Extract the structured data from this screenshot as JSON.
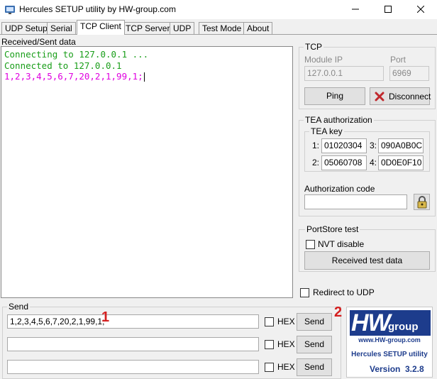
{
  "window": {
    "title": "Hercules SETUP utility by HW-group.com"
  },
  "tabs": [
    {
      "label": "UDP Setup"
    },
    {
      "label": "Serial"
    },
    {
      "label": "TCP Client"
    },
    {
      "label": "TCP Server"
    },
    {
      "label": "UDP"
    },
    {
      "label": "Test Mode"
    },
    {
      "label": "About"
    }
  ],
  "received": {
    "label": "Received/Sent data",
    "lines": [
      "Connecting to 127.0.0.1 ...",
      "Connected to 127.0.0.1",
      "1,2,3,4,5,6,7,20,2,1,99,1;"
    ]
  },
  "tcp": {
    "group_label": "TCP",
    "module_ip_label": "Module IP",
    "module_ip_value": "127.0.0.1",
    "port_label": "Port",
    "port_value": "6969",
    "ping_label": "Ping",
    "disconnect_label": "Disconnect"
  },
  "tea": {
    "group_label": "TEA authorization",
    "key_label": "TEA key",
    "k1_label": "1:",
    "k1": "01020304",
    "k2_label": "2:",
    "k2": "05060708",
    "k3_label": "3:",
    "k3": "090A0B0C",
    "k4_label": "4:",
    "k4": "0D0E0F10",
    "auth_label": "Authorization code",
    "auth_value": ""
  },
  "portstore": {
    "group_label": "PortStore test",
    "nvt_label": "NVT disable",
    "received_test_label": "Received test data"
  },
  "redirect_label": "Redirect to UDP",
  "send": {
    "group_label": "Send",
    "rows": [
      {
        "value": "1,2,3,4,5,6,7,20,2,1,99,1;",
        "hex_label": "HEX",
        "send_label": "Send"
      },
      {
        "value": "",
        "hex_label": "HEX",
        "send_label": "Send"
      },
      {
        "value": "",
        "hex_label": "HEX",
        "send_label": "Send"
      }
    ]
  },
  "annotations": {
    "a1": "1",
    "a2": "2"
  },
  "logo": {
    "brand_hw": "HW",
    "brand_group": "group",
    "url": "www.HW-group.com",
    "product": "Hercules SETUP utility",
    "version_label": "Version",
    "version": "3.2.8"
  },
  "colors": {
    "received_green": "#1a9e1a",
    "sent_magenta": "#e000e0",
    "annotation_red": "#d42020",
    "logo_blue": "#1d3c8c"
  }
}
